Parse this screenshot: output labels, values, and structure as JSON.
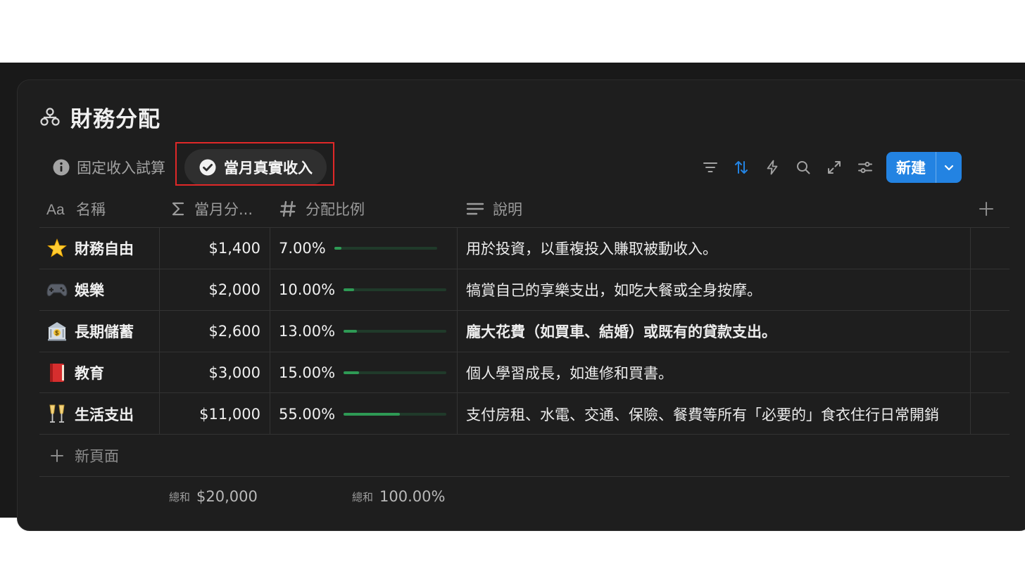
{
  "database": {
    "title": "財務分配",
    "title_icon": "hierarchy-icon"
  },
  "views": {
    "tabs": [
      {
        "label": "固定收入試算",
        "icon": "info-circle-icon",
        "active": false
      },
      {
        "label": "當月真實收入",
        "icon": "check-circle-icon",
        "active": true
      }
    ]
  },
  "toolbar": {
    "icons": [
      "filter-icon",
      "sort-icon",
      "automation-icon",
      "search-icon",
      "expand-icon",
      "settings-sliders-icon"
    ],
    "sort_active_color": "#2383e2",
    "new_label": "新建"
  },
  "columns": [
    {
      "label": "名稱",
      "icon": "text-Aa-icon"
    },
    {
      "label": "當月分...",
      "icon": "sigma-icon"
    },
    {
      "label": "分配比例",
      "icon": "number-hash-icon"
    },
    {
      "label": "說明",
      "icon": "text-lines-icon"
    }
  ],
  "rows": [
    {
      "emoji": "🌟",
      "name": "財務自由",
      "amount": "$1,400",
      "percent": "7.00%",
      "ratio": 0.07,
      "desc": "用於投資，以重複投入賺取被動收入。",
      "desc_bold": false
    },
    {
      "emoji": "🎮",
      "name": "娛樂",
      "amount": "$2,000",
      "percent": "10.00%",
      "ratio": 0.1,
      "desc": "犒賞自己的享樂支出，如吃大餐或全身按摩。",
      "desc_bold": false
    },
    {
      "emoji": "🏦",
      "name": "長期儲蓄",
      "amount": "$2,600",
      "percent": "13.00%",
      "ratio": 0.13,
      "desc": "龐大花費（如買車、結婚）或既有的貸款支出。",
      "desc_bold": true
    },
    {
      "emoji": "📕",
      "name": "教育",
      "amount": "$3,000",
      "percent": "15.00%",
      "ratio": 0.15,
      "desc": "個人學習成長，如進修和買書。",
      "desc_bold": false
    },
    {
      "emoji": "🥂",
      "name": "生活支出",
      "amount": "$11,000",
      "percent": "55.00%",
      "ratio": 0.55,
      "desc": "支付房租、水電、交通、保險、餐費等所有「必要的」食衣住行日常開銷",
      "desc_bold": false
    }
  ],
  "new_page_label": "新頁面",
  "summary": {
    "amount_label": "總和",
    "amount_value": "$20,000",
    "percent_label": "總和",
    "percent_value": "100.00%"
  },
  "colors": {
    "accent": "#2383e2",
    "progress": "#2e9a55",
    "highlight_box": "#e02828"
  }
}
